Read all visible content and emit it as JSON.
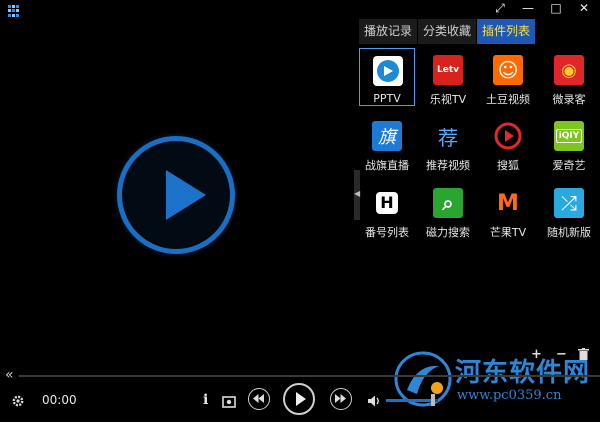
{
  "window": {
    "logo_icon": "app-logo-icon",
    "buttons": [
      "fullscreen-toggle-icon",
      "minimize-icon",
      "maximize-icon",
      "close-icon"
    ],
    "glyphs": {
      "fullscreen": "⤢",
      "minimize": "—",
      "maximize": "□",
      "close": "✕"
    }
  },
  "panel": {
    "tabs": [
      {
        "label": "播放记录",
        "active": false
      },
      {
        "label": "分类收藏",
        "active": false
      },
      {
        "label": "插件列表",
        "active": true
      }
    ],
    "plugins": [
      {
        "label": "PPTV",
        "icon": "pptv-icon",
        "color": "#ffffff",
        "glyph": "",
        "selected": true
      },
      {
        "label": "乐视TV",
        "icon": "letv-icon",
        "color": "#d8231c",
        "glyph": "Letv",
        "selected": false
      },
      {
        "label": "土豆视频",
        "icon": "tudou-icon",
        "color": "#ff6a00",
        "glyph": "☺",
        "selected": false
      },
      {
        "label": "微录客",
        "icon": "weilu-icon",
        "color": "#e0262b",
        "glyph": "◉",
        "selected": false
      },
      {
        "label": "战旗直播",
        "icon": "zhanqi-icon",
        "color": "#1f7ad6",
        "glyph": "旗",
        "selected": false
      },
      {
        "label": "推荐视频",
        "icon": "recommend-icon",
        "color": "#000000",
        "glyph": "荐",
        "selected": false
      },
      {
        "label": "搜狐",
        "icon": "sohu-icon",
        "color": "#000000",
        "glyph": "▶",
        "selected": false
      },
      {
        "label": "爱奇艺",
        "icon": "iqiyi-icon",
        "color": "#7cc61d",
        "glyph": "iQIY",
        "selected": false
      },
      {
        "label": "番号列表",
        "icon": "fanhao-icon",
        "color": "#ffffff",
        "glyph": "H",
        "selected": false
      },
      {
        "label": "磁力搜索",
        "icon": "magnet-search-icon",
        "color": "#2aa52f",
        "glyph": "⌕",
        "selected": false
      },
      {
        "label": "芒果TV",
        "icon": "mango-tv-icon",
        "color": "#000000",
        "glyph": "M",
        "selected": false
      },
      {
        "label": "随机新版",
        "icon": "random-icon",
        "color": "#29a9e0",
        "glyph": "⤮",
        "selected": false
      }
    ],
    "list_tools": {
      "add": "+",
      "remove": "−",
      "delete_icon": "trash-icon"
    }
  },
  "watermark": {
    "name": "河东软件网",
    "url": "www.pc0359.cn"
  },
  "player": {
    "current_time": "00:00",
    "expand_glyph": "«",
    "info_glyph": "i",
    "volume_level": 0.9,
    "accent": "#1e6fc6"
  }
}
